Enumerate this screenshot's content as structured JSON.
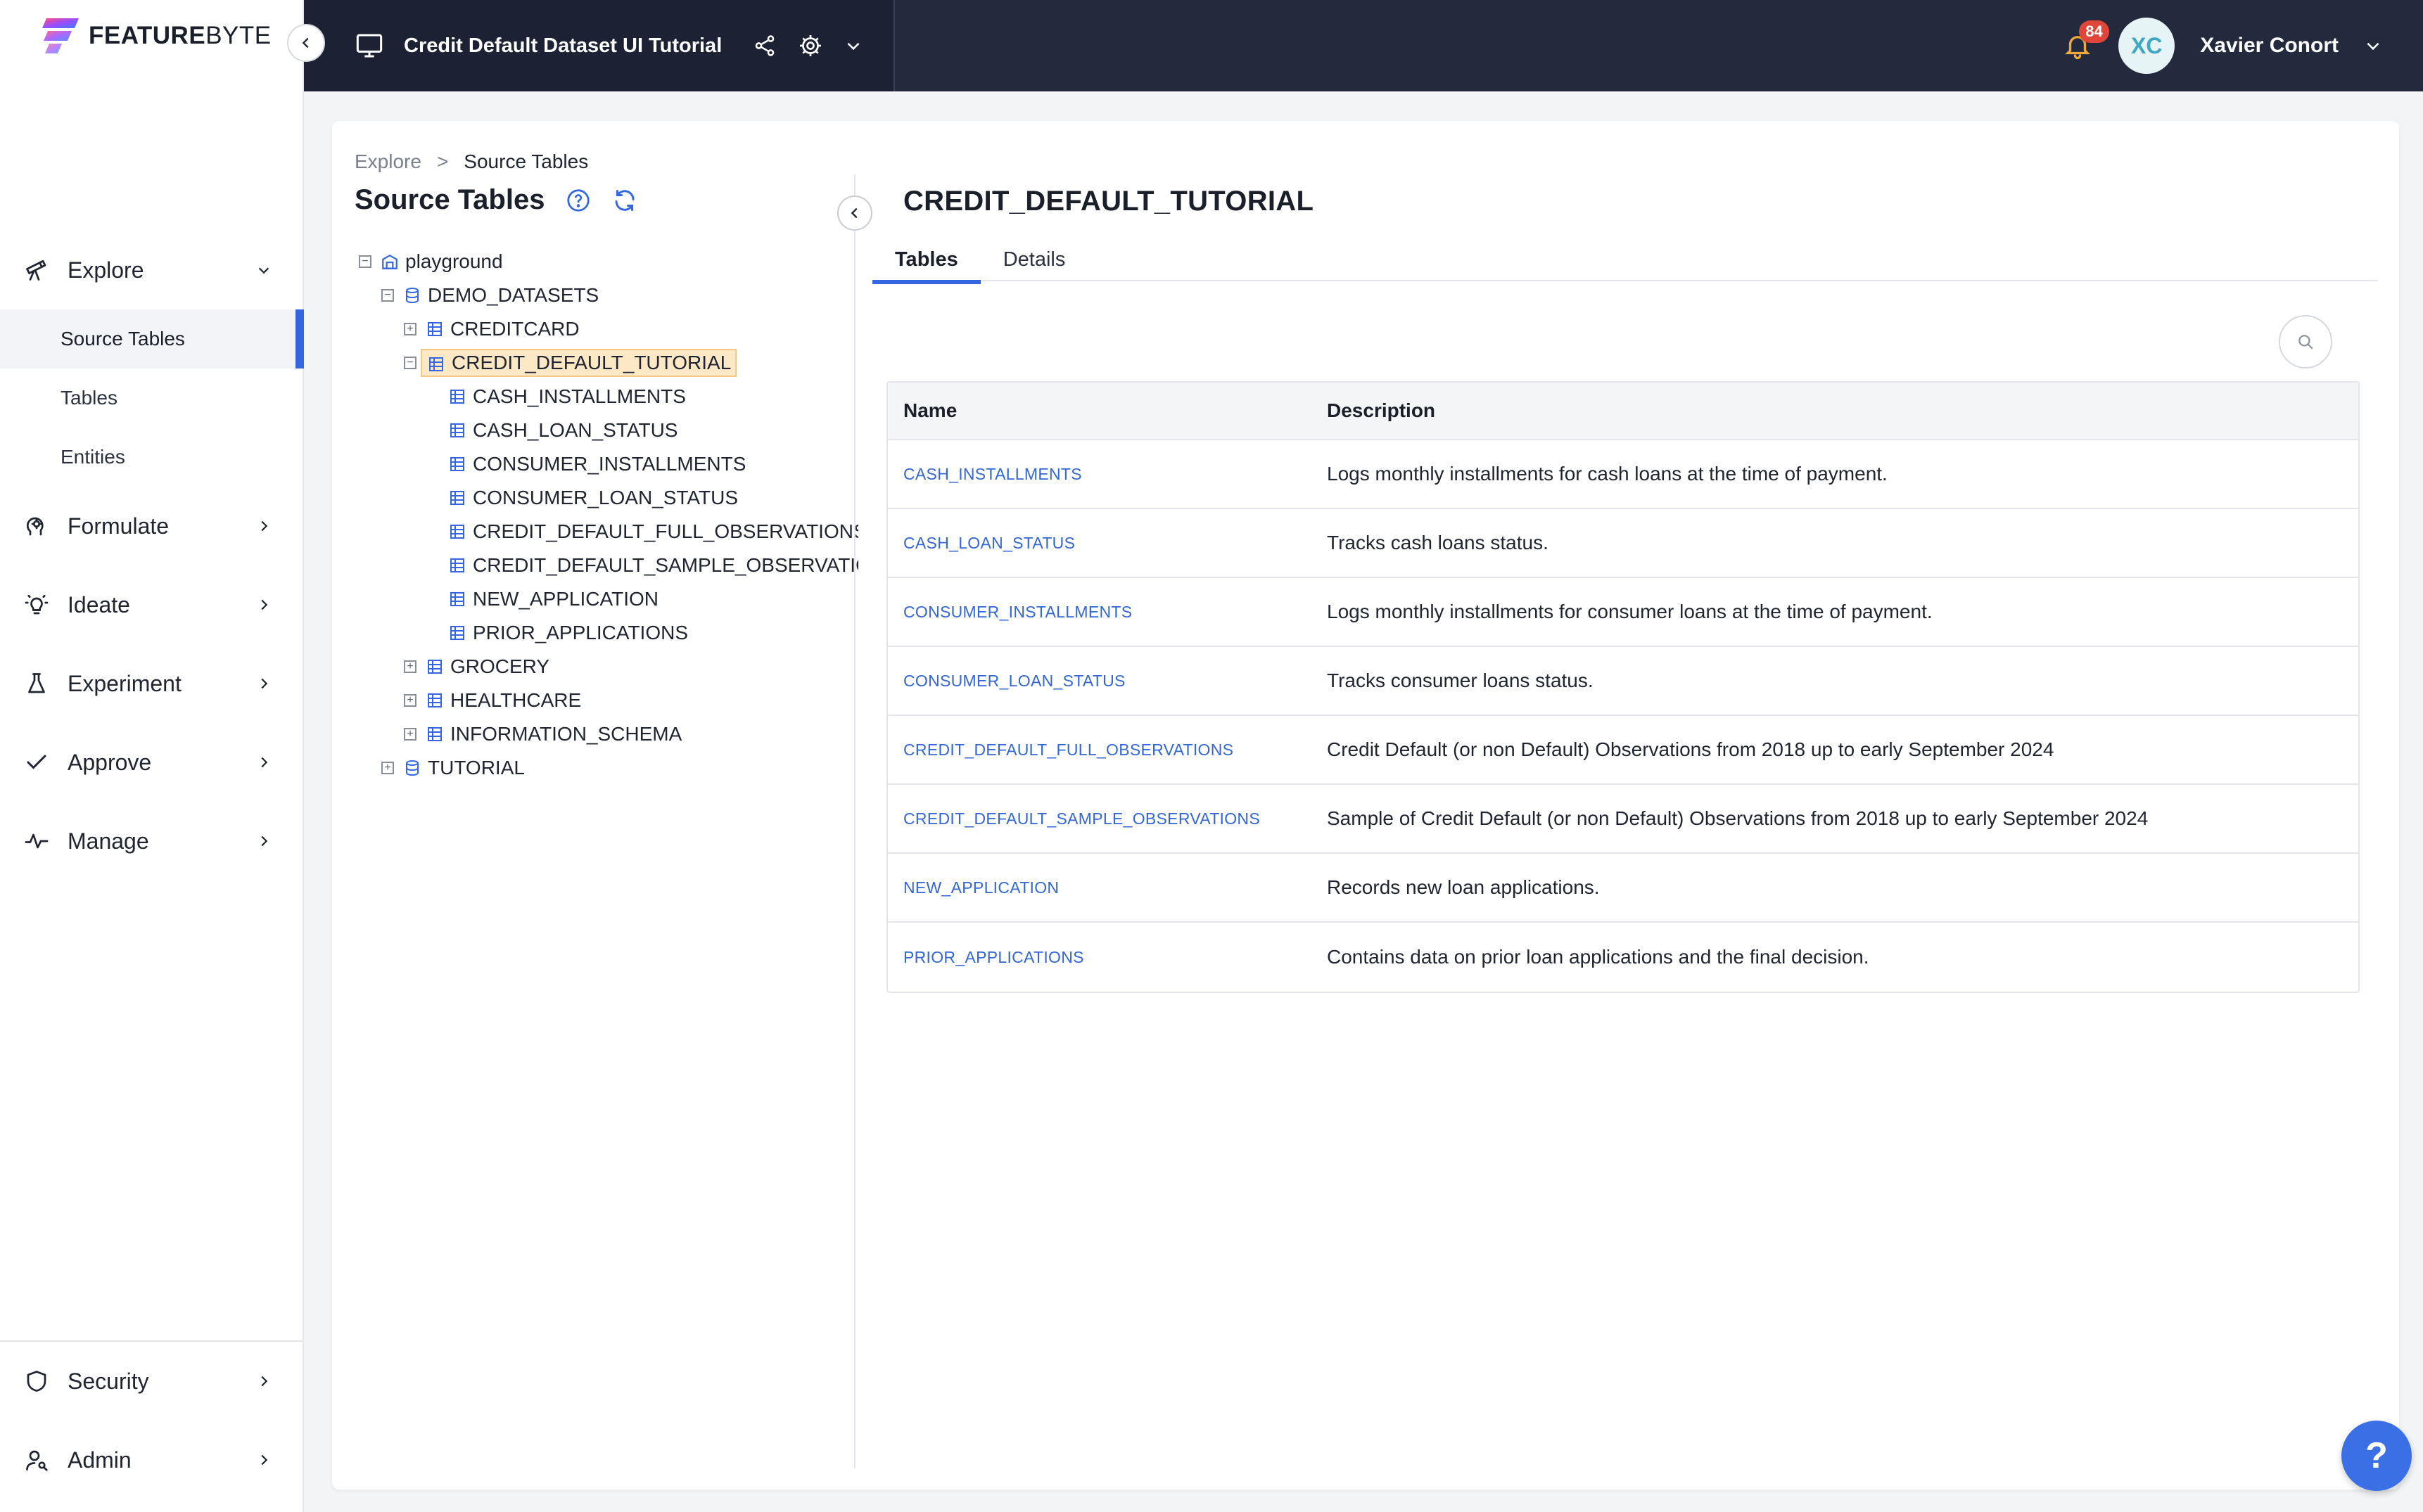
{
  "brand": {
    "name_bold": "FEATURE",
    "name_light": "BYTE"
  },
  "topbar": {
    "catalog_title": "Credit Default Dataset UI Tutorial",
    "notification_count": "84",
    "user_initials": "XC",
    "user_name": "Xavier Conort"
  },
  "sidebar": {
    "items": [
      {
        "label": "Explore",
        "icon": "telescope-icon"
      },
      {
        "label": "Formulate",
        "icon": "head-icon"
      },
      {
        "label": "Ideate",
        "icon": "lightbulb-icon"
      },
      {
        "label": "Experiment",
        "icon": "flask-icon"
      },
      {
        "label": "Approve",
        "icon": "check-icon"
      },
      {
        "label": "Manage",
        "icon": "pulse-icon"
      }
    ],
    "explore_sub": [
      "Source Tables",
      "Tables",
      "Entities"
    ],
    "bottom": [
      {
        "label": "Security",
        "icon": "shield-icon"
      },
      {
        "label": "Admin",
        "icon": "user-key-icon"
      }
    ]
  },
  "breadcrumb": {
    "parent": "Explore",
    "separator": ">",
    "current": "Source Tables"
  },
  "panel": {
    "title": "Source Tables"
  },
  "tree": {
    "root": "playground",
    "db": "DEMO_DATASETS",
    "schemas": [
      "CREDITCARD",
      "CREDIT_DEFAULT_TUTORIAL",
      "GROCERY",
      "HEALTHCARE",
      "INFORMATION_SCHEMA"
    ],
    "tables": [
      "CASH_INSTALLMENTS",
      "CASH_LOAN_STATUS",
      "CONSUMER_INSTALLMENTS",
      "CONSUMER_LOAN_STATUS",
      "CREDIT_DEFAULT_FULL_OBSERVATIONS",
      "CREDIT_DEFAULT_SAMPLE_OBSERVATIONS",
      "NEW_APPLICATION",
      "PRIOR_APPLICATIONS"
    ],
    "other_db": "TUTORIAL"
  },
  "detail": {
    "title": "CREDIT_DEFAULT_TUTORIAL",
    "tabs": [
      "Tables",
      "Details"
    ],
    "columns": [
      "Name",
      "Description"
    ],
    "rows": [
      {
        "name": "CASH_INSTALLMENTS",
        "description": "Logs monthly installments for cash loans at the time of payment."
      },
      {
        "name": "CASH_LOAN_STATUS",
        "description": "Tracks cash loans status."
      },
      {
        "name": "CONSUMER_INSTALLMENTS",
        "description": "Logs monthly installments for consumer loans at the time of payment."
      },
      {
        "name": "CONSUMER_LOAN_STATUS",
        "description": "Tracks consumer loans status."
      },
      {
        "name": "CREDIT_DEFAULT_FULL_OBSERVATIONS",
        "description": "Credit Default (or non Default) Observations from 2018 up to early September 2024"
      },
      {
        "name": "CREDIT_DEFAULT_SAMPLE_OBSERVATIONS",
        "description": "Sample of Credit Default (or non Default) Observations from 2018 up to early September 2024"
      },
      {
        "name": "NEW_APPLICATION",
        "description": "Records new loan applications."
      },
      {
        "name": "PRIOR_APPLICATIONS",
        "description": "Contains data on prior loan applications and the final decision."
      }
    ]
  },
  "help": {
    "label": "?"
  },
  "colors": {
    "accent": "#3366e0",
    "topbar": "#232a3d",
    "link": "#3366d6",
    "selected_bg": "#fde8c6",
    "badge": "#e0453a"
  }
}
